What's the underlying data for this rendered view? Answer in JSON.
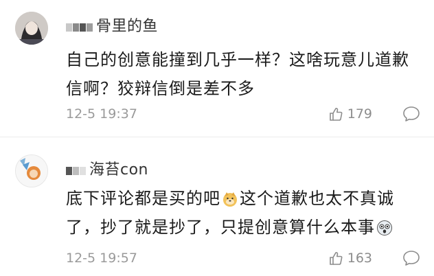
{
  "comments": [
    {
      "username": "骨里的鱼",
      "text": "自己的创意能撞到几乎一样？这啥玩意儿道歉信啊？狡辩信倒是差不多",
      "time": "12-5 19:37",
      "likes": "179"
    },
    {
      "username": "海苔con",
      "text_part1": "底下评论都是买的吧",
      "text_part2": "这个道歉也太不真诚了，抄了就是抄了，只提创意算什么本事",
      "time": "12-5 19:57",
      "likes": "163"
    }
  ],
  "icons": {
    "like": "thumbs-up-icon",
    "reply": "speech-bubble-icon"
  },
  "colors": {
    "text": "#1a1a1a",
    "meta": "#9a9a9a",
    "divider": "#ececec"
  }
}
